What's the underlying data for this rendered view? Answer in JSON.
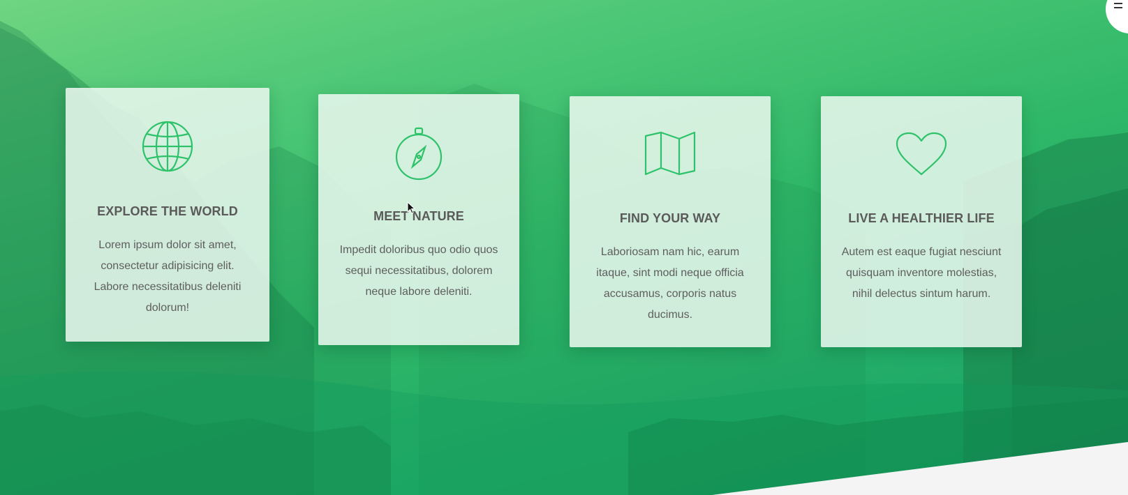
{
  "features": [
    {
      "icon": "globe-icon",
      "title": "EXPLORE THE WORLD",
      "text": "Lorem ipsum dolor sit amet, consectetur adipisicing elit. Labore necessitatibus deleniti dolorum!"
    },
    {
      "icon": "compass-icon",
      "title": "MEET NATURE",
      "text": "Impedit doloribus quo odio quos sequi necessitatibus, dolorem neque labore deleniti."
    },
    {
      "icon": "map-icon",
      "title": "FIND YOUR WAY",
      "text": "Laboriosam nam hic, earum itaque, sint modi neque officia accusamus, corporis natus ducimus."
    },
    {
      "icon": "heart-icon",
      "title": "LIVE A HEALTHIER LIFE",
      "text": "Autem est eaque fugiat nesciunt quisquam inventore molestias, nihil delectus sintum harum."
    }
  ],
  "colors": {
    "icon_green": "#2ec26a",
    "hero_gradient_start": "#6fd581",
    "hero_gradient_end": "#1aa063",
    "card_text": "#5e5e5e"
  },
  "nav": {
    "icon": "menu-icon"
  }
}
